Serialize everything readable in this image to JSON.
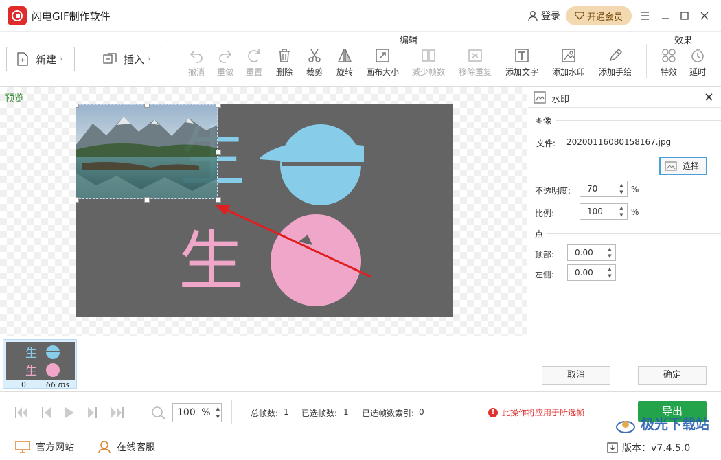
{
  "window": {
    "title": "闪电GIF制作软件",
    "login_label": "登录",
    "vip_label": "开通会员"
  },
  "toolbar": {
    "new_label": "新建",
    "insert_label": "插入",
    "edit_group_label": "编辑",
    "effect_group_label": "效果",
    "tools": [
      {
        "label": "撤消",
        "icon": "undo-icon",
        "enabled": false
      },
      {
        "label": "重做",
        "icon": "redo-icon",
        "enabled": false
      },
      {
        "label": "重置",
        "icon": "reset-icon",
        "enabled": false
      },
      {
        "label": "删除",
        "icon": "trash-icon",
        "enabled": true
      },
      {
        "label": "裁剪",
        "icon": "scissors-icon",
        "enabled": true
      },
      {
        "label": "旋转",
        "icon": "rotate-icon",
        "enabled": true
      },
      {
        "label": "画布大小",
        "icon": "canvas-size-icon",
        "enabled": true
      },
      {
        "label": "减少帧数",
        "icon": "reduce-frames-icon",
        "enabled": false
      },
      {
        "label": "移除重复",
        "icon": "remove-duplicate-icon",
        "enabled": false
      },
      {
        "label": "添加文字",
        "icon": "text-icon",
        "enabled": true
      },
      {
        "label": "添加水印",
        "icon": "watermark-icon",
        "enabled": true
      },
      {
        "label": "添加手绘",
        "icon": "pencil-icon",
        "enabled": true
      }
    ],
    "effect_tools": [
      {
        "label": "特效",
        "icon": "effects-icon",
        "enabled": true
      },
      {
        "label": "延时",
        "icon": "timer-icon",
        "enabled": true
      }
    ]
  },
  "preview": {
    "label": "预览",
    "canvas_glyph_top": "生",
    "canvas_glyph_bottom": "生"
  },
  "frames": [
    {
      "index": "0",
      "duration": "66 ms"
    }
  ],
  "watermark_panel": {
    "title": "水印",
    "image_section": "图像",
    "file_label": "文件:",
    "file_name": "20200116080158167.jpg",
    "select_label": "选择",
    "opacity_label": "不透明度:",
    "opacity_value": "70",
    "scale_label": "比例:",
    "scale_value": "100",
    "percent": "%",
    "point_section": "点",
    "top_label": "顶部:",
    "top_value": "0.00",
    "left_label": "左侧:",
    "left_value": "0.00",
    "cancel_label": "取消",
    "ok_label": "确定"
  },
  "playback": {
    "zoom_value": "100",
    "zoom_unit": "%",
    "total_frames_label": "总帧数:",
    "total_frames_value": "1",
    "selected_frames_label": "已选帧数:",
    "selected_frames_value": "1",
    "selected_index_label": "已选帧数索引:",
    "selected_index_value": "0",
    "warning": "此操作将应用于所选帧",
    "export_label": "导出"
  },
  "footer": {
    "website_label": "官方网站",
    "support_label": "在线客服",
    "version_label": "版本：v7.4.5.0",
    "watermark_brand": "极光下载站"
  },
  "colors": {
    "accent_green": "#23a44a",
    "warning_red": "#e03131",
    "canvas_bg": "#646464",
    "cyan_shape": "#87cdea",
    "pink_shape": "#f0a6c8"
  }
}
